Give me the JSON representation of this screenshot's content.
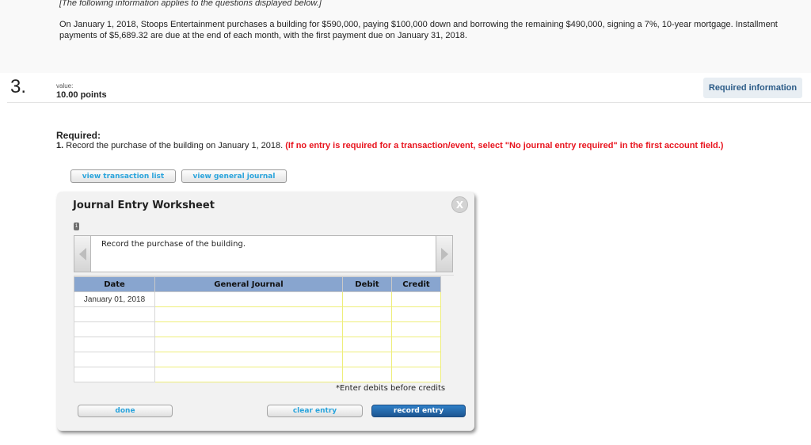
{
  "intro": {
    "note": "[The following information applies to the questions displayed below.]",
    "text": "On January 1, 2018, Stoops Entertainment purchases a building for $590,000, paying $100,000 down and borrowing the remaining $490,000, signing a 7%, 10-year mortgage. Installment payments of $5,689.32 are due at the end of each month, with the first payment due on January 31, 2018."
  },
  "question": {
    "number": "3.",
    "value_label": "value:",
    "points": "10.00 points",
    "required_info_button": "Required information"
  },
  "required": {
    "label": "Required:",
    "item_number": "1.",
    "item_text": " Record the purchase of the building on January 1, 2018. ",
    "item_note": "(If no entry is required for a transaction/event, select \"No journal entry required\" in the first account field.)"
  },
  "buttons": {
    "view_transaction_list": "view transaction list",
    "view_general_journal": "view general journal"
  },
  "worksheet": {
    "title": "Journal Entry Worksheet",
    "close_label": "X",
    "step": "1",
    "description": "Record the purchase of the building.",
    "columns": [
      "Date",
      "General Journal",
      "Debit",
      "Credit"
    ],
    "rows": [
      {
        "date": "January 01, 2018",
        "account": "",
        "debit": "",
        "credit": ""
      },
      {
        "date": "",
        "account": "",
        "debit": "",
        "credit": ""
      },
      {
        "date": "",
        "account": "",
        "debit": "",
        "credit": ""
      },
      {
        "date": "",
        "account": "",
        "debit": "",
        "credit": ""
      },
      {
        "date": "",
        "account": "",
        "debit": "",
        "credit": ""
      },
      {
        "date": "",
        "account": "",
        "debit": "",
        "credit": ""
      }
    ],
    "hint": "*Enter debits before credits",
    "done_label": "done",
    "clear_label": "clear entry",
    "record_label": "record entry"
  },
  "colors": {
    "accent_blue": "#2aa4dc",
    "header_blue": "#88a5cf",
    "warning_red": "#e8141e",
    "primary_button": "#1d5591"
  }
}
